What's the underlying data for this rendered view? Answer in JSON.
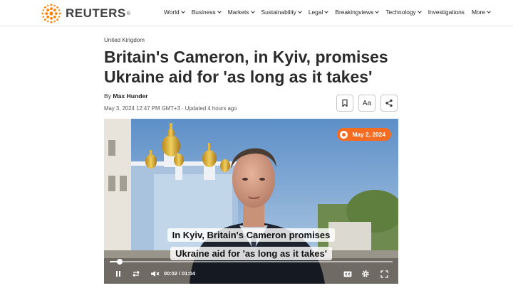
{
  "logo": {
    "text": "REUTERS",
    "reg": "®"
  },
  "nav": [
    {
      "label": "World",
      "has_chevron": true
    },
    {
      "label": "Business",
      "has_chevron": true
    },
    {
      "label": "Markets",
      "has_chevron": true
    },
    {
      "label": "Sustainability",
      "has_chevron": true
    },
    {
      "label": "Legal",
      "has_chevron": true
    },
    {
      "label": "Breakingviews",
      "has_chevron": true
    },
    {
      "label": "Technology",
      "has_chevron": true
    },
    {
      "label": "Investigations",
      "has_chevron": false
    },
    {
      "label": "More",
      "has_chevron": true
    }
  ],
  "article": {
    "kicker": "United Kingdom",
    "headline": "Britain's Cameron, in Kyiv, promises Ukraine aid for 'as long as it takes'",
    "by_prefix": "By",
    "author": "Max Hunder",
    "dateline": "May 3, 2024 12:47 PM GMT+3 · Updated 4 hours ago"
  },
  "tools": {
    "font_size_label": "Aa"
  },
  "video": {
    "date_badge": "May 2, 2024",
    "caption_line1": "In Kyiv, Britain's Cameron promises",
    "caption_line2": "Ukraine aid for 'as long as it takes'",
    "current_time": "00:02",
    "time_separator": "/",
    "duration": "01:04",
    "progress_fraction": 0.035
  },
  "colors": {
    "accent": "#f36c21",
    "brand": "#ff8000"
  }
}
